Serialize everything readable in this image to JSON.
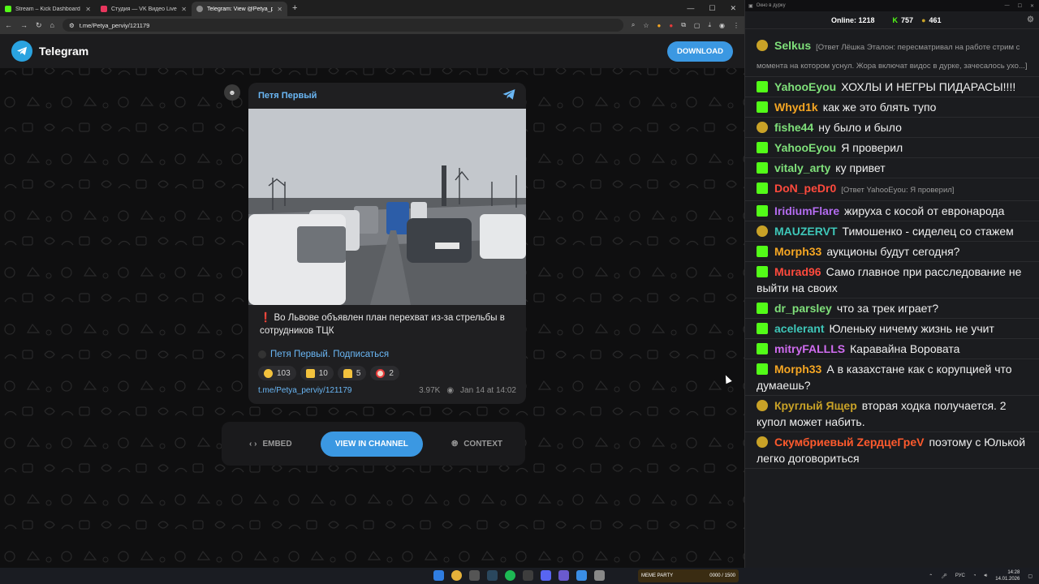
{
  "browser": {
    "tabs": [
      {
        "title": "Stream – Kick Dashboard",
        "color": "#53fc18",
        "active": false
      },
      {
        "title": "Студия — VK Видео Live",
        "color": "#e8365d",
        "active": false
      },
      {
        "title": "Telegram: View @Petya_perviy",
        "color": "#8a8a8a",
        "active": true
      }
    ],
    "url": "t.me/Petya_perviy/121179"
  },
  "telegram": {
    "brand": "Telegram",
    "download": "DOWNLOAD",
    "channel": "Петя Первый",
    "post_text": "❗ Во Львове объявлен план перехват из-за стрельбы в сотрудников ТЦК",
    "subscribe": "Петя Первый. Подписаться",
    "reactions": [
      {
        "icon": "sad-face",
        "count": "103",
        "color": "#f3c23d"
      },
      {
        "icon": "thumbs-up",
        "count": "10",
        "color": "#f3c23d"
      },
      {
        "icon": "praying-hands",
        "count": "5",
        "color": "#f3c23d"
      },
      {
        "icon": "clown-face",
        "count": "2",
        "color": "#f0d8c8"
      }
    ],
    "post_link": "t.me/Petya_perviy/121179",
    "views": "3.97K",
    "date": "Jan 14 at 14:02",
    "embed": "EMBED",
    "view_in_channel": "VIEW IN CHANNEL",
    "context": "CONTEXT"
  },
  "chat": {
    "window_title": "Окно в дурку",
    "online_label": "Online:",
    "online_count": "1218",
    "kick_count": "757",
    "vk_count": "461",
    "messages": [
      {
        "nick": "Selkus",
        "nick_color": "#7fe07a",
        "badge": "vk",
        "reply": "[Ответ Лёшка Эталон: пересматривал на работе стрим с момента на котором уснул. Жора включат видос в дурке, зачесалось ухо...]",
        "text": ""
      },
      {
        "nick": "YahooEyou",
        "nick_color": "#7fe07a",
        "badge": "kick",
        "reply": "",
        "text": "ХОХЛЫ И НЕГРЫ ПИДАРАСЫ!!!!"
      },
      {
        "nick": "Whyd1k",
        "nick_color": "#f5a623",
        "badge": "kick",
        "reply": "",
        "text": "как же это блять тупо"
      },
      {
        "nick": "fishe44",
        "nick_color": "#7fe07a",
        "badge": "vk",
        "reply": "",
        "text": "ну было и было"
      },
      {
        "nick": "YahooEyou",
        "nick_color": "#7fe07a",
        "badge": "kick",
        "reply": "",
        "text": "Я проверил"
      },
      {
        "nick": "vitaly_arty",
        "nick_color": "#7fe07a",
        "badge": "kick",
        "reply": "",
        "text": "ку привет"
      },
      {
        "nick": "DoN_peDr0",
        "nick_color": "#ff4a3d",
        "badge": "kick",
        "reply": "[Ответ YahooEyou: Я проверил]",
        "text": ""
      },
      {
        "nick": "IridiumFlare",
        "nick_color": "#b46cf0",
        "badge": "kick",
        "reply": "",
        "text": "жируха с косой от евронарода"
      },
      {
        "nick": "MAUZERVT",
        "nick_color": "#3ec6b8",
        "badge": "vk",
        "reply": "",
        "text": "Тимошенко - сиделец со стажем"
      },
      {
        "nick": "Morph33",
        "nick_color": "#f5a623",
        "badge": "kick",
        "reply": "",
        "text": "аукционы будут сегодня?"
      },
      {
        "nick": "Murad96",
        "nick_color": "#ff4a3d",
        "badge": "kick",
        "reply": "",
        "text": "Само главное при расследование не выйти на своих"
      },
      {
        "nick": "dr_parsley",
        "nick_color": "#7fe07a",
        "badge": "kick",
        "reply": "",
        "text": "что за трек играет?"
      },
      {
        "nick": "acelerant",
        "nick_color": "#3ec6b8",
        "badge": "kick",
        "reply": "",
        "text": "Юленьку ничему жизнь не учит"
      },
      {
        "nick": "mitryFALLLS",
        "nick_color": "#d06cf0",
        "badge": "kick",
        "reply": "",
        "text": "Каравайна Воровата"
      },
      {
        "nick": "Morph33",
        "nick_color": "#f5a623",
        "badge": "kick",
        "reply": "",
        "text": "А в казахстане как с корупцией что думаешь?"
      },
      {
        "nick": "Круглый Ящер",
        "nick_color": "#c9a227",
        "badge": "vk",
        "reply": "",
        "text": "вторая ходка получается. 2 купол может набить."
      },
      {
        "nick": "Скумбриевый ZeрдцеГреV",
        "nick_color": "#ff5a2d",
        "badge": "vk",
        "reply": "",
        "text": "поэтому с Юлькой легко договориться"
      }
    ]
  },
  "taskbar": {
    "widget": "MEME PARTY",
    "widget_progress": "0000 / 1500",
    "lang": "РУС",
    "time": "14:28",
    "date": "14.01.2026"
  }
}
